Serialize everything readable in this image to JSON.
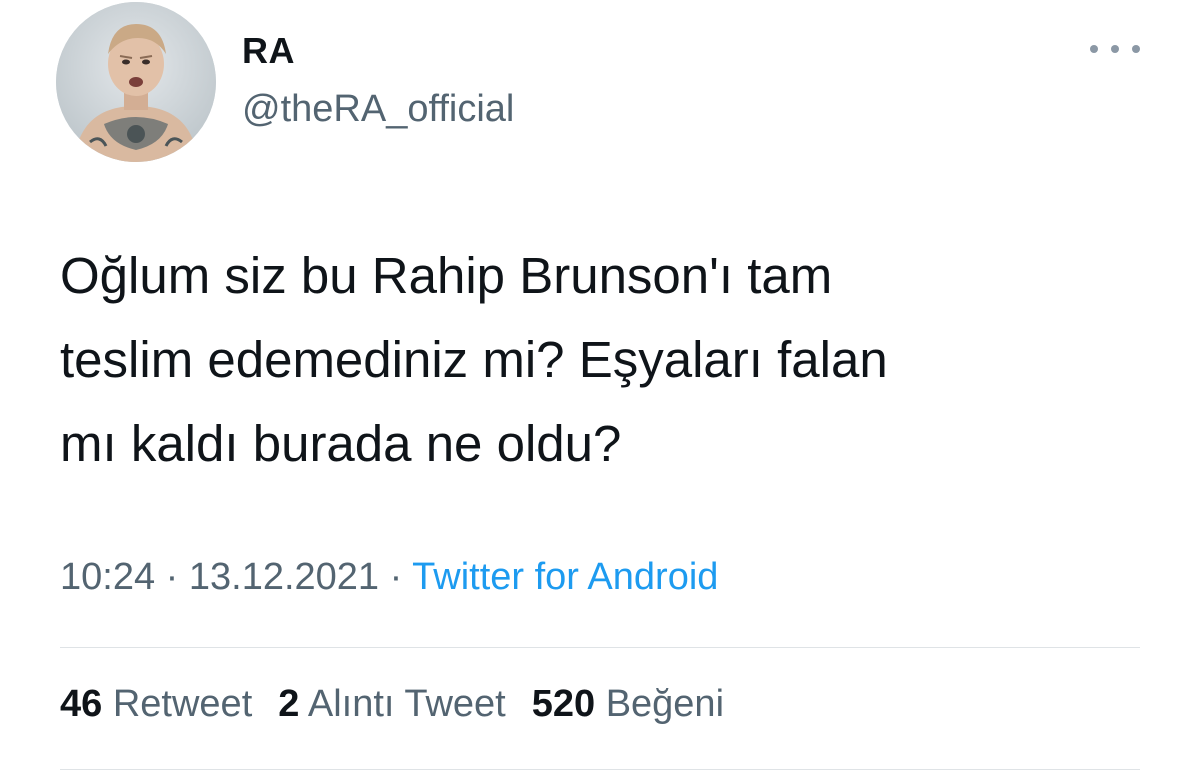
{
  "author": {
    "display_name": "RA",
    "handle": "@theRA_official"
  },
  "tweet": {
    "text": "Oğlum siz bu Rahip Brunson'ı tam\nteslim edemediniz mi? Eşyaları falan\nmı kaldı burada ne oldu?",
    "time": "10:24",
    "date": "13.12.2021",
    "separator": "·",
    "source": "Twitter for Android"
  },
  "stats": {
    "retweets": {
      "count": "46",
      "label": "Retweet"
    },
    "quotes": {
      "count": "2",
      "label": "Alıntı Tweet"
    },
    "likes": {
      "count": "520",
      "label": "Beğeni"
    }
  },
  "icons": {
    "more": "more-horizontal-icon"
  },
  "colors": {
    "text": "#0f1419",
    "secondary": "#536471",
    "link": "#1d9bf0",
    "divider": "#dfe3e6"
  }
}
